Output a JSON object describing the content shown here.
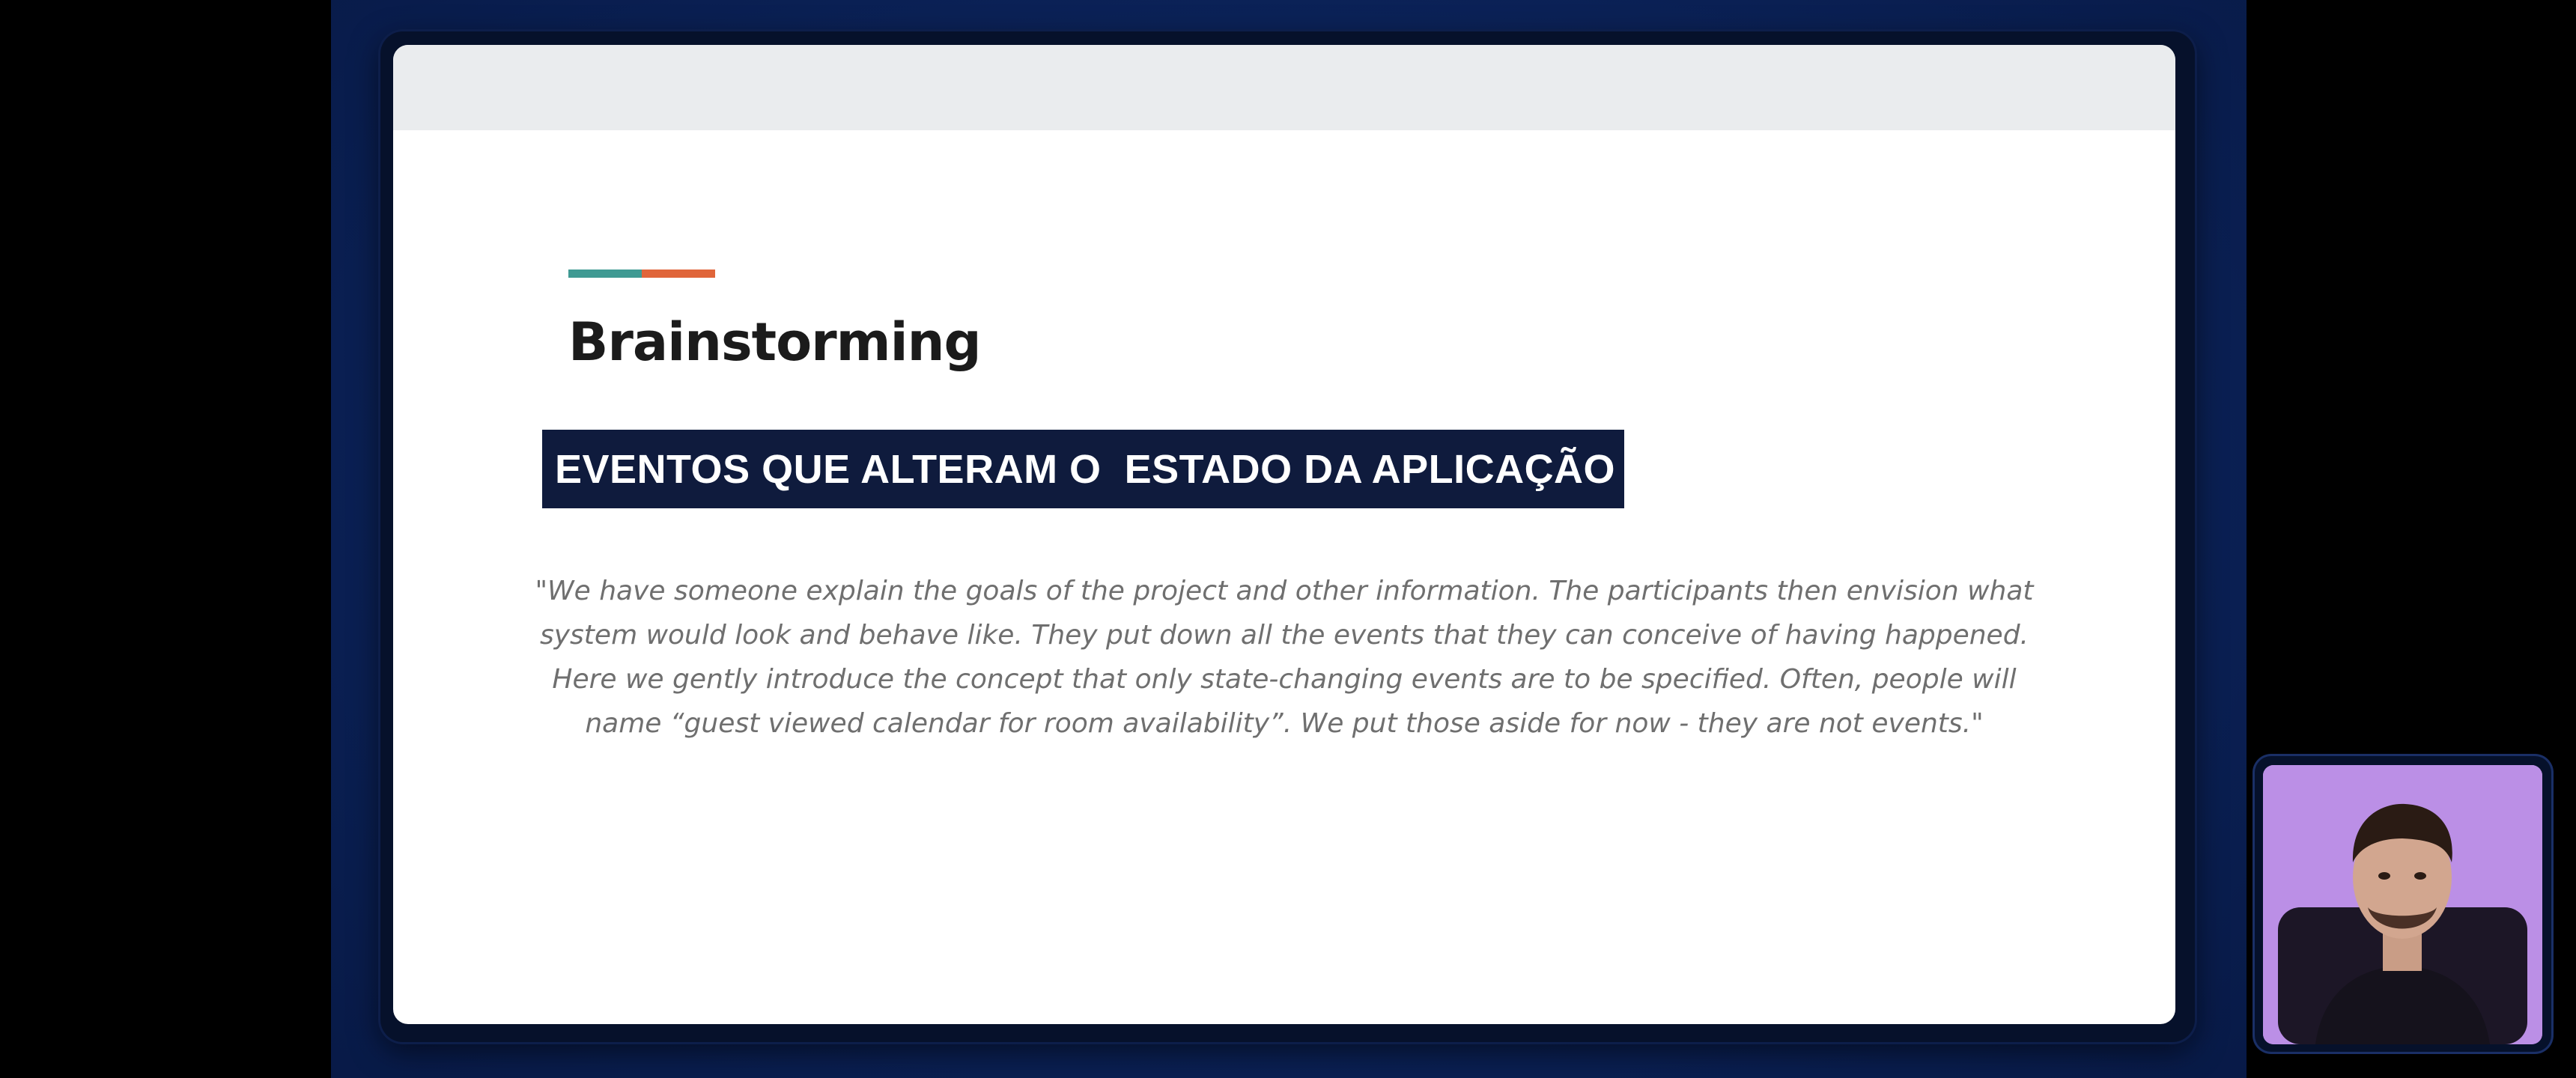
{
  "slide": {
    "title": "Brainstorming",
    "highlight": "EVENTOS QUE ALTERAM O  ESTADO DA APLICAÇÃO",
    "quote": "\"We have someone explain the goals of the project and other information. The participants then envision what system would look and behave like. They put down all the events that they can conceive of having happened. Here we gently introduce the concept that only state-changing events are to be specified. Often, people will name “guest viewed calendar for room availability”. We put those aside for now - they are not events.\""
  },
  "colors": {
    "accent_teal": "#3f9a93",
    "accent_orange": "#e0653a",
    "highlight_bg": "#0f1b3d",
    "frame_bg": "#0b2258"
  },
  "webcam": {
    "icon": "presenter-video"
  }
}
